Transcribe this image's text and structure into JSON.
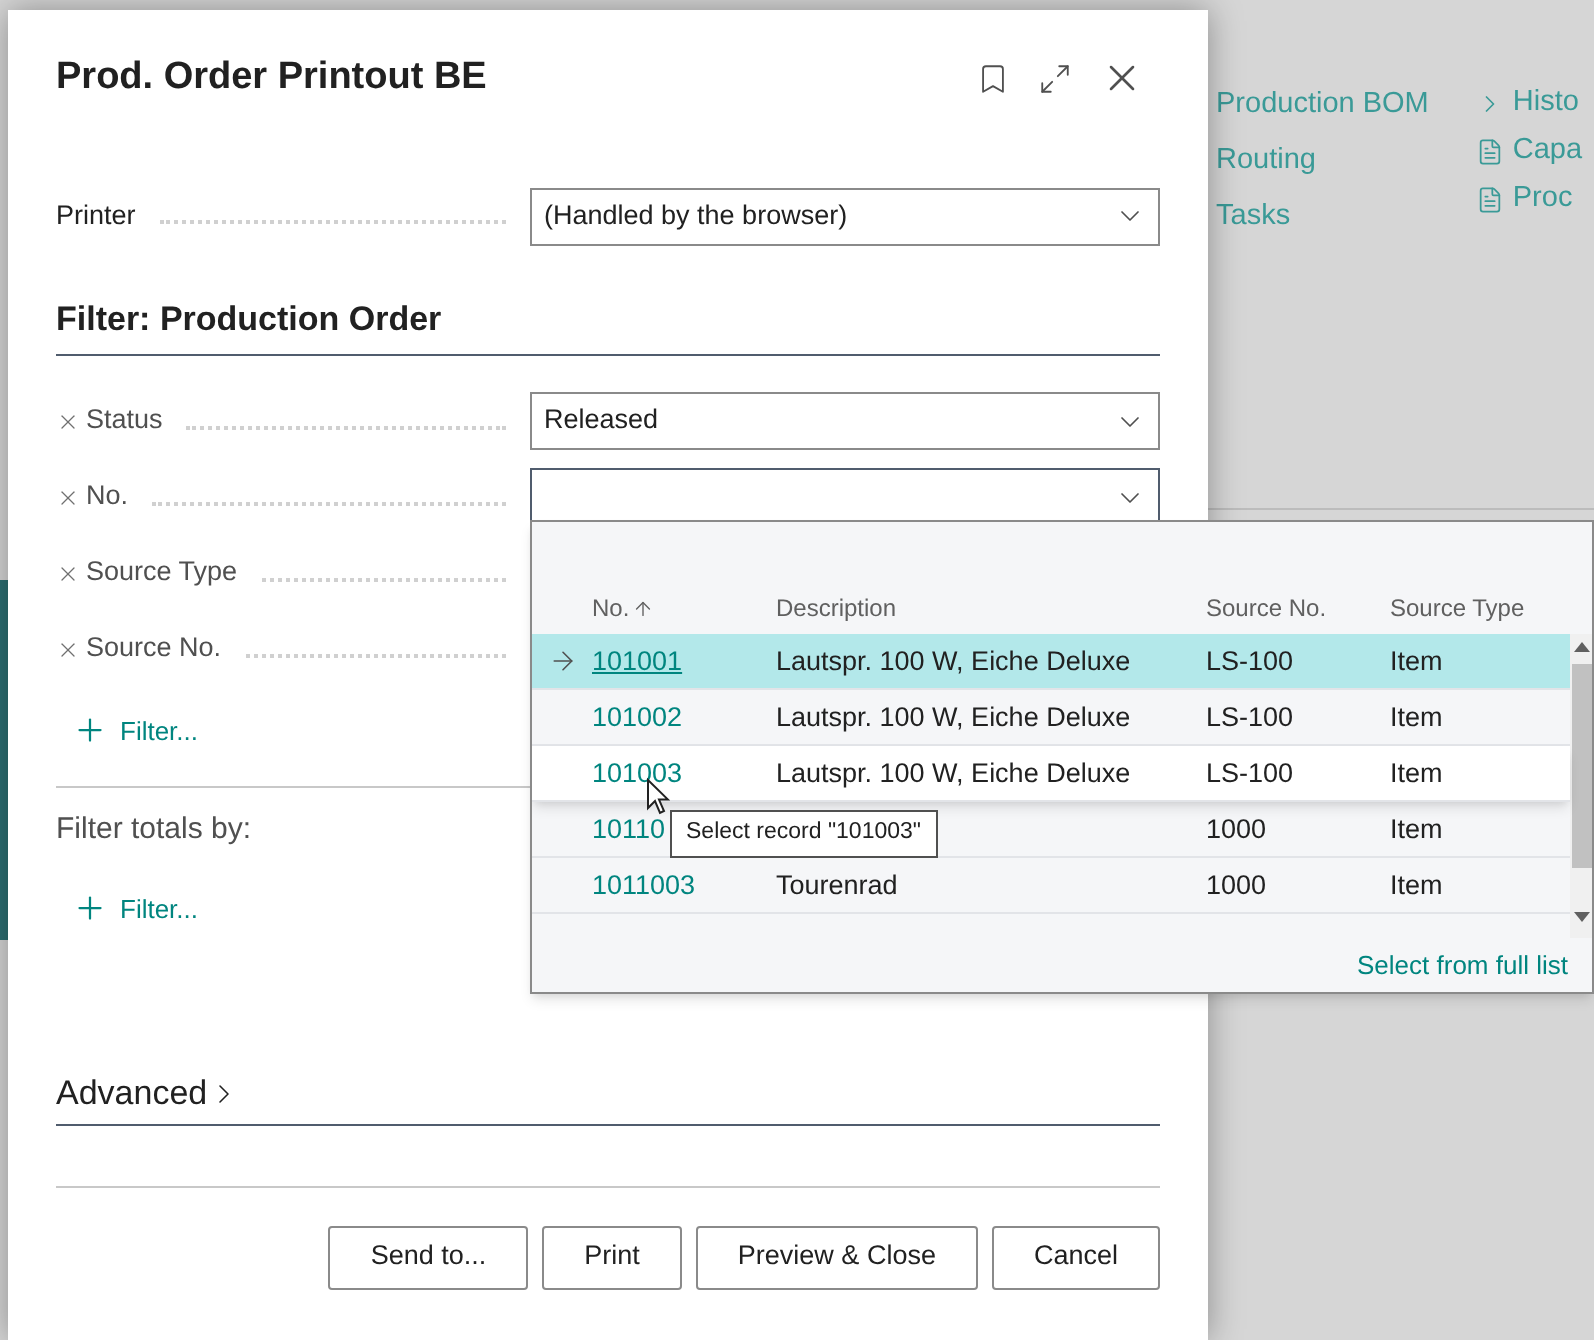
{
  "background": {
    "links_column_1": [
      {
        "label": "Production BOM"
      },
      {
        "label": "Routing"
      },
      {
        "label": "Tasks"
      }
    ],
    "links_column_2": [
      {
        "label": "Histo",
        "kind": "expand"
      },
      {
        "label": "Capa",
        "kind": "report"
      },
      {
        "label": "Proc",
        "kind": "report"
      }
    ]
  },
  "dialog": {
    "title": "Prod. Order Printout BE"
  },
  "printer": {
    "label": "Printer",
    "value": "(Handled by the browser)"
  },
  "filter_section": {
    "title": "Filter: Production Order",
    "fields": [
      {
        "label": "Status",
        "kind": "dropdown",
        "value": "Released",
        "focused": false
      },
      {
        "label": "No.",
        "kind": "dropdown",
        "focused": true
      },
      {
        "label": "Source Type",
        "kind": "covered"
      },
      {
        "label": "Source No.",
        "kind": "covered"
      }
    ],
    "add_filter": "Filter..."
  },
  "totals": {
    "title": "Filter totals by:",
    "add_filter": "Filter..."
  },
  "advanced": {
    "title": "Advanced",
    "expanded": false
  },
  "buttons": [
    "Send to...",
    "Print",
    "Preview & Close",
    "Cancel"
  ],
  "lookup": {
    "columns": [
      {
        "label": "No.",
        "sorted": true
      },
      {
        "label": "Description",
        "sorted": false
      },
      {
        "label": "Source No.",
        "sorted": false
      },
      {
        "label": "Source Type",
        "sorted": false
      }
    ],
    "rows": [
      {
        "no": "101001",
        "description": "Lautspr. 100 W, Eiche Deluxe",
        "source_no": "LS-100",
        "source_type": "Item",
        "selected": true,
        "hovered": false
      },
      {
        "no": "101002",
        "description": "Lautspr. 100 W, Eiche Deluxe",
        "source_no": "LS-100",
        "source_type": "Item",
        "selected": false,
        "hovered": false
      },
      {
        "no": "101003",
        "description": "Lautspr. 100 W, Eiche Deluxe",
        "source_no": "LS-100",
        "source_type": "Item",
        "selected": false,
        "hovered": true
      },
      {
        "no": "10110",
        "source_no": "1000",
        "source_type": "Item",
        "selected": false,
        "hovered": false
      },
      {
        "no": "1011003",
        "description": "Tourenrad",
        "source_no": "1000",
        "source_type": "Item",
        "selected": false,
        "hovered": false
      }
    ],
    "tooltip": "Select record \"101003\"",
    "footer_link": "Select from full list"
  }
}
